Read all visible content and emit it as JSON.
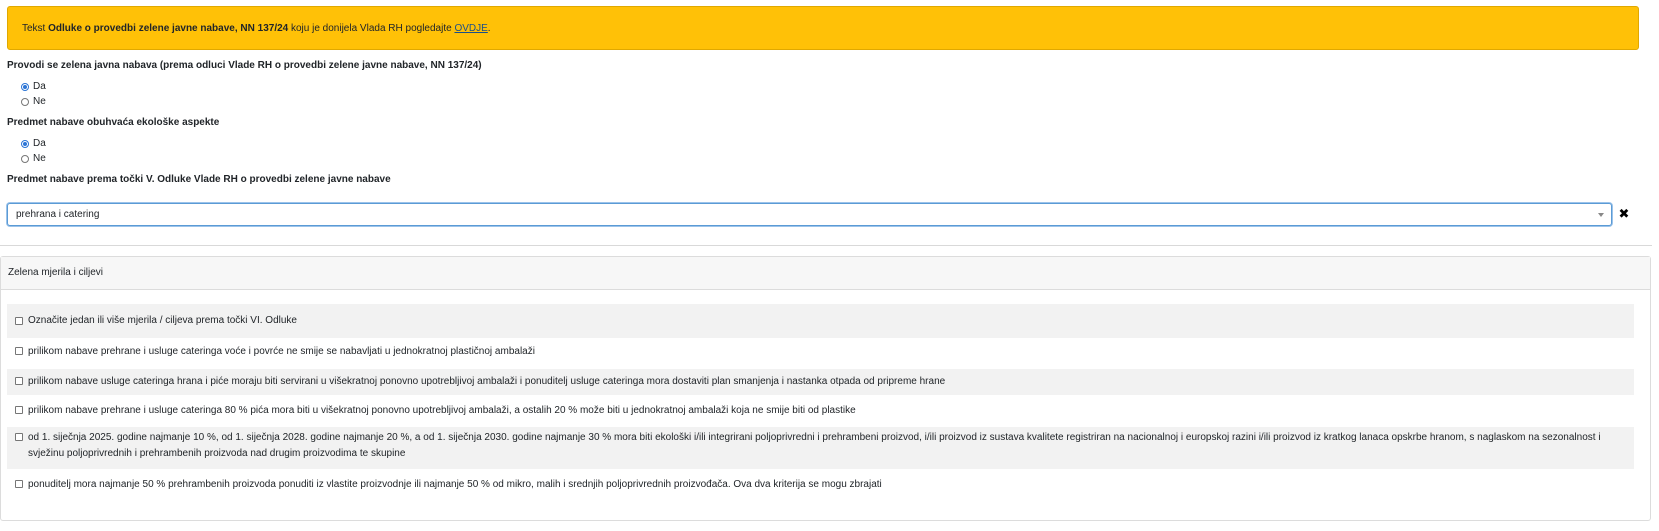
{
  "alert": {
    "prefix": "Tekst ",
    "bold": "Odluke o provedbi zelene javne nabave, NN 137/24",
    "middle": " koju je donijela Vlada RH pogledajte ",
    "link": "OVDJE",
    "suffix": "."
  },
  "q1": {
    "label": "Provodi se zelena javna nabava (prema odluci Vlade RH o provedbi zelene javne nabave, NN 137/24)",
    "options": [
      {
        "label": "Da",
        "checked": true
      },
      {
        "label": "Ne",
        "checked": false
      }
    ]
  },
  "q2": {
    "label": "Predmet nabave obuhvaća ekološke aspekte",
    "options": [
      {
        "label": "Da",
        "checked": true
      },
      {
        "label": "Ne",
        "checked": false
      }
    ]
  },
  "q3": {
    "label": "Predmet nabave prema točki V. Odluke Vlade RH o provedbi zelene javne nabave",
    "selected": "prehrana i catering",
    "clear_glyph": "✖"
  },
  "panel": {
    "title": "Zelena mjerila i ciljevi",
    "items": [
      {
        "text": "Označite jedan ili više mjerila / ciljeva prema točki VI. Odluke",
        "checked": false
      },
      {
        "text": "prilikom nabave prehrane i usluge cateringa voće i povrće ne smije se nabavljati u jednokratnoj plastičnoj ambalaži",
        "checked": false
      },
      {
        "text": "prilikom nabave usluge cateringa hrana i piće moraju biti servirani u višekratnoj ponovno upotrebljivoj ambalaži i ponuditelj usluge cateringa mora dostaviti plan smanjenja i nastanka otpada od pripreme hrane",
        "checked": false
      },
      {
        "text": "prilikom nabave prehrane i usluge cateringa 80 % pića mora biti u višekratnoj ponovno upotrebljivoj ambalaži, a ostalih 20 % može biti u jednokratnoj ambalaži koja ne smije biti od plastike",
        "checked": false
      },
      {
        "text": "od 1. siječnja 2025. godine najmanje 10 %, od 1. siječnja 2028. godine najmanje 20 %, a od 1. siječnja 2030. godine najmanje 30 % mora biti ekološki i/ili integrirani poljoprivredni i prehrambeni proizvod, i/ili proizvod iz sustava kvalitete registriran na nacionalnoj i europskoj razini i/ili proizvod iz kratkog lanaca opskrbe hranom, s naglaskom na sezonalnost i svježinu poljoprivrednih i prehrambenih proizvoda nad drugim proizvodima te skupine",
        "checked": false
      },
      {
        "text": "ponuditelj mora najmanje 50 % prehrambenih proizvoda ponuditi iz vlastite proizvodnje ili najmanje 50 % od mikro, malih i srednjih poljoprivrednih proizvođača. Ova dva kriterija se mogu zbrajati",
        "checked": false
      }
    ]
  }
}
